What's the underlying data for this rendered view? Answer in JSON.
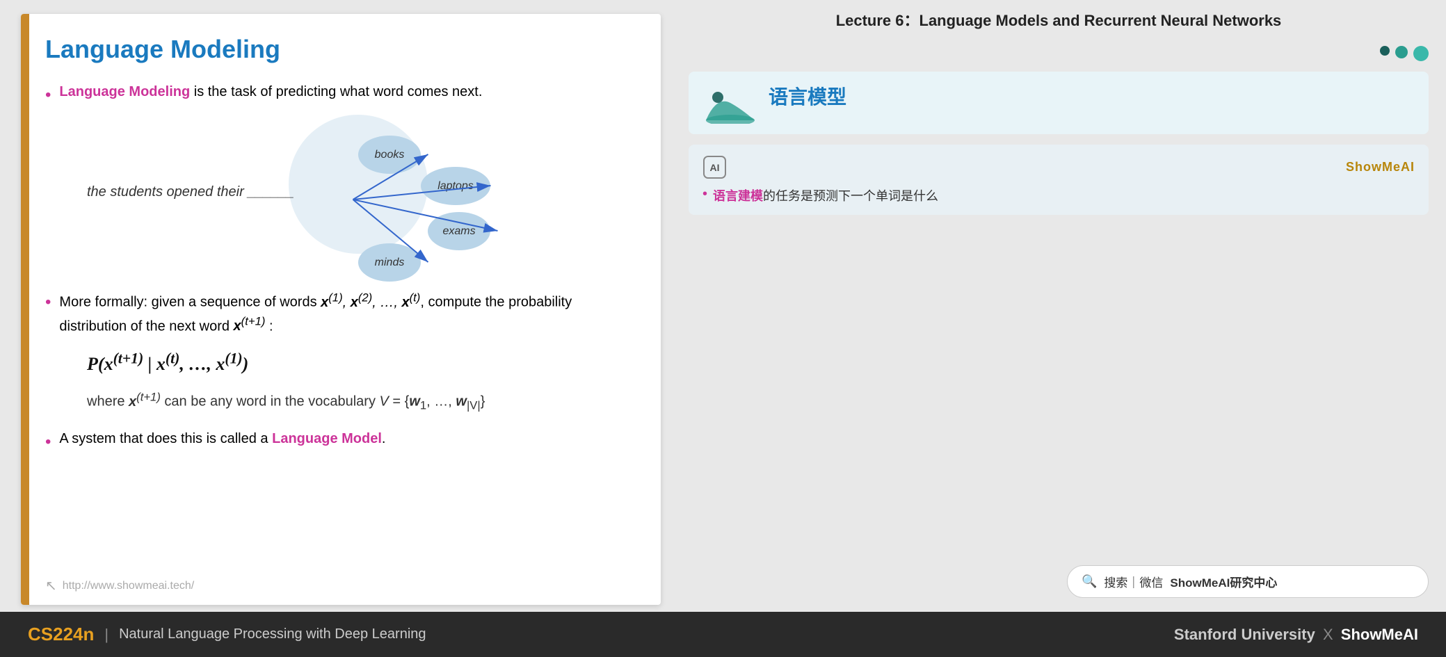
{
  "slide": {
    "title": "Language Modeling",
    "left_bar_color": "#c8882a",
    "bullets": [
      {
        "id": 1,
        "prefix": "",
        "highlight": "Language Modeling",
        "highlight_color": "#cc3399",
        "text": " is the task of predicting what word comes next."
      },
      {
        "id": 2,
        "text": "More formally: given a sequence of words x(1), x(2), ..., x(t), compute the probability distribution of the next word x(t+1):"
      },
      {
        "id": 3,
        "prefix": "A system that does this is called a ",
        "highlight": "Language Model",
        "highlight_color": "#cc3399",
        "text": "."
      }
    ],
    "sentence_example": "the students opened their ______",
    "word_bubbles": [
      "books",
      "laptops",
      "exams",
      "minds"
    ],
    "math_formula": "P(x(t+1) | x(t), ..., x(1))",
    "math_where": "where x(t+1) can be any word in the vocabulary V = {w₁, ..., w|V|}",
    "footer_url": "http://www.showmeai.tech/"
  },
  "right": {
    "lecture_title": "Lecture 6：Language Models and Recurrent Neural Networks",
    "chinese_title": "语言模型",
    "translation_brand": "ShowMeAI",
    "translation_bullet": "语言建模的任务是预测下一个单词是什么",
    "translation_highlight": "语言建模",
    "search_text": "搜索｜微信 ShowMeAI研究中心"
  },
  "bottom_bar": {
    "course_code": "CS224n",
    "separator": "|",
    "course_name": "Natural Language Processing with Deep Learning",
    "university": "Stanford University",
    "cross": "X",
    "brand": "ShowMeAI"
  }
}
